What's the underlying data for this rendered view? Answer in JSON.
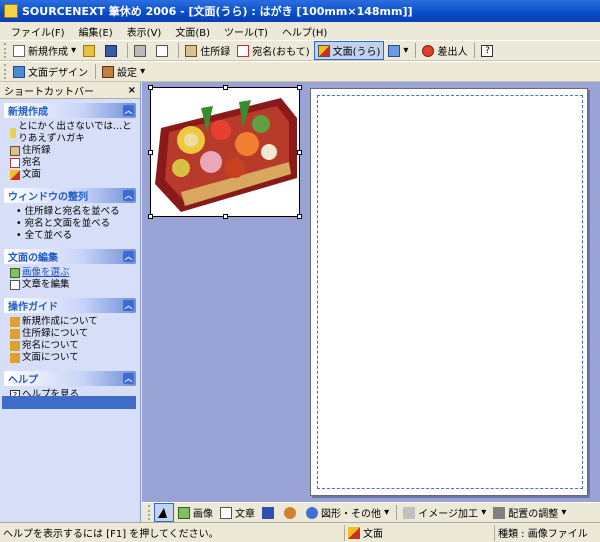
{
  "window": {
    "title": "SOURCENEXT 筆休め 2006 - [文面(うら) : はがき [100mm×148mm]]"
  },
  "menu": [
    "ファイル(F)",
    "編集(E)",
    "表示(V)",
    "文面(B)",
    "ツール(T)",
    "ヘルプ(H)"
  ],
  "toolbar1": {
    "new_label": "新規作成",
    "address_book_label": "住所録",
    "addressee_label": "宛名(おもて)",
    "message_side_label": "文面(うら)",
    "sender_label": "差出人"
  },
  "toolbar2": {
    "design_label": "文面デザイン",
    "settings_label": "設定"
  },
  "shortcut": {
    "title": "ショートカットバー",
    "close": "×",
    "sections": [
      {
        "title": "新規作成",
        "items": [
          "とにかく出さないでは...とりあえずハガキ",
          "住所録",
          "宛名",
          "文面"
        ]
      },
      {
        "title": "ウィンドウの整列",
        "items": [
          "住所録と宛名を並べる",
          "宛名と文面を並べる",
          "全て並べる"
        ]
      },
      {
        "title": "文面の編集",
        "items": [
          "画像を選ぶ",
          "文章を編集"
        ]
      },
      {
        "title": "操作ガイド",
        "items": [
          "新規作成について",
          "住所録について",
          "宛名について",
          "文面について"
        ]
      },
      {
        "title": "ヘルプ",
        "items": [
          "ヘルプを見る"
        ]
      }
    ]
  },
  "bottombar": {
    "image_label": "画像",
    "text_label": "文章",
    "shapes_label": "図形・その他",
    "image_edit_label": "イメージ加工",
    "layout_label": "配置の調整"
  },
  "status": {
    "hint": "ヘルプを表示するには [F1] を押してください。",
    "view": "文面",
    "type": "種類 : 画像ファイル"
  },
  "colors": {
    "title_blue": "#0a4cc8",
    "canvas": "#9aa3d6",
    "panel": "#d6dff7",
    "section_text": "#215dc6"
  }
}
